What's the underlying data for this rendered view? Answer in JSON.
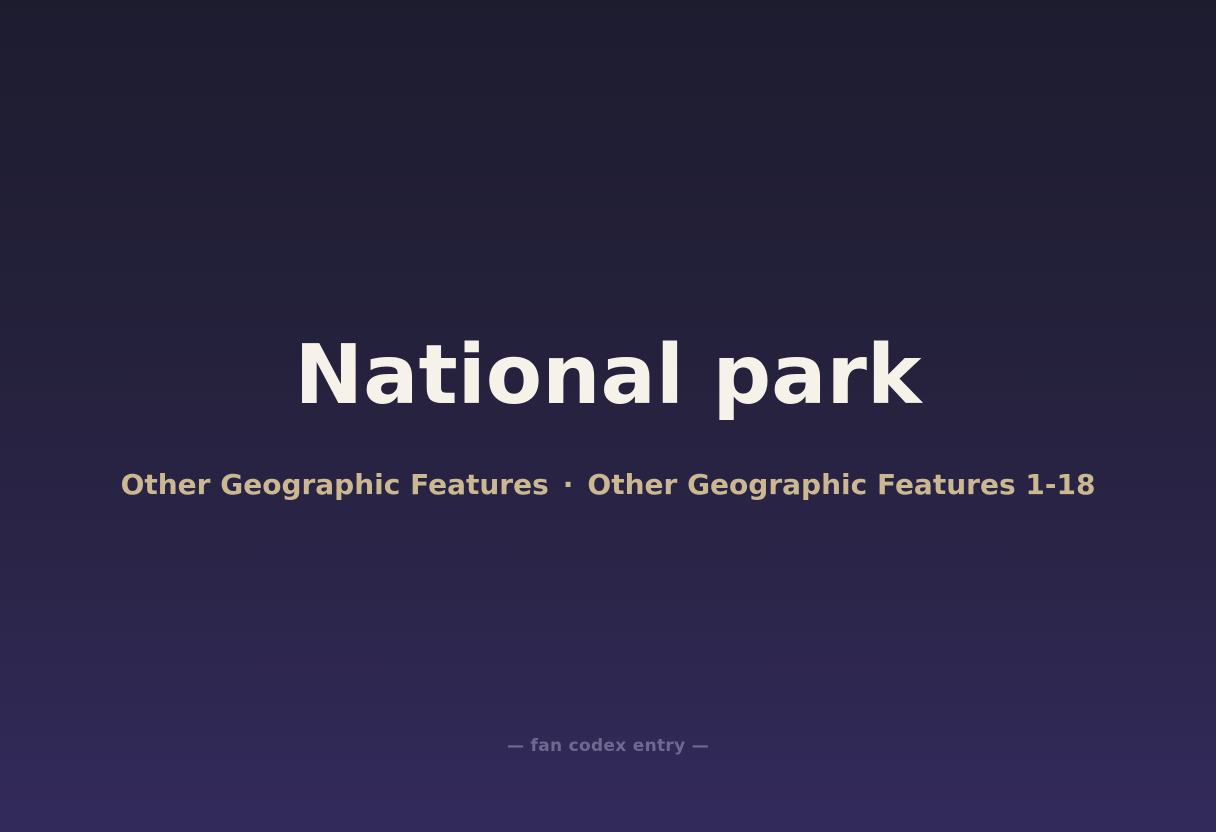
{
  "title": "National park",
  "subtitle": {
    "category": "Other Geographic Features",
    "separator": "·",
    "range": "Other Geographic Features 1-18"
  },
  "footer": "— fan codex entry —",
  "colors": {
    "background_top": "#1d1c2f",
    "background_bottom": "#332a5c",
    "title": "#f6f1e9",
    "subtitle": "#cbb791",
    "footer": "#6f6890"
  }
}
